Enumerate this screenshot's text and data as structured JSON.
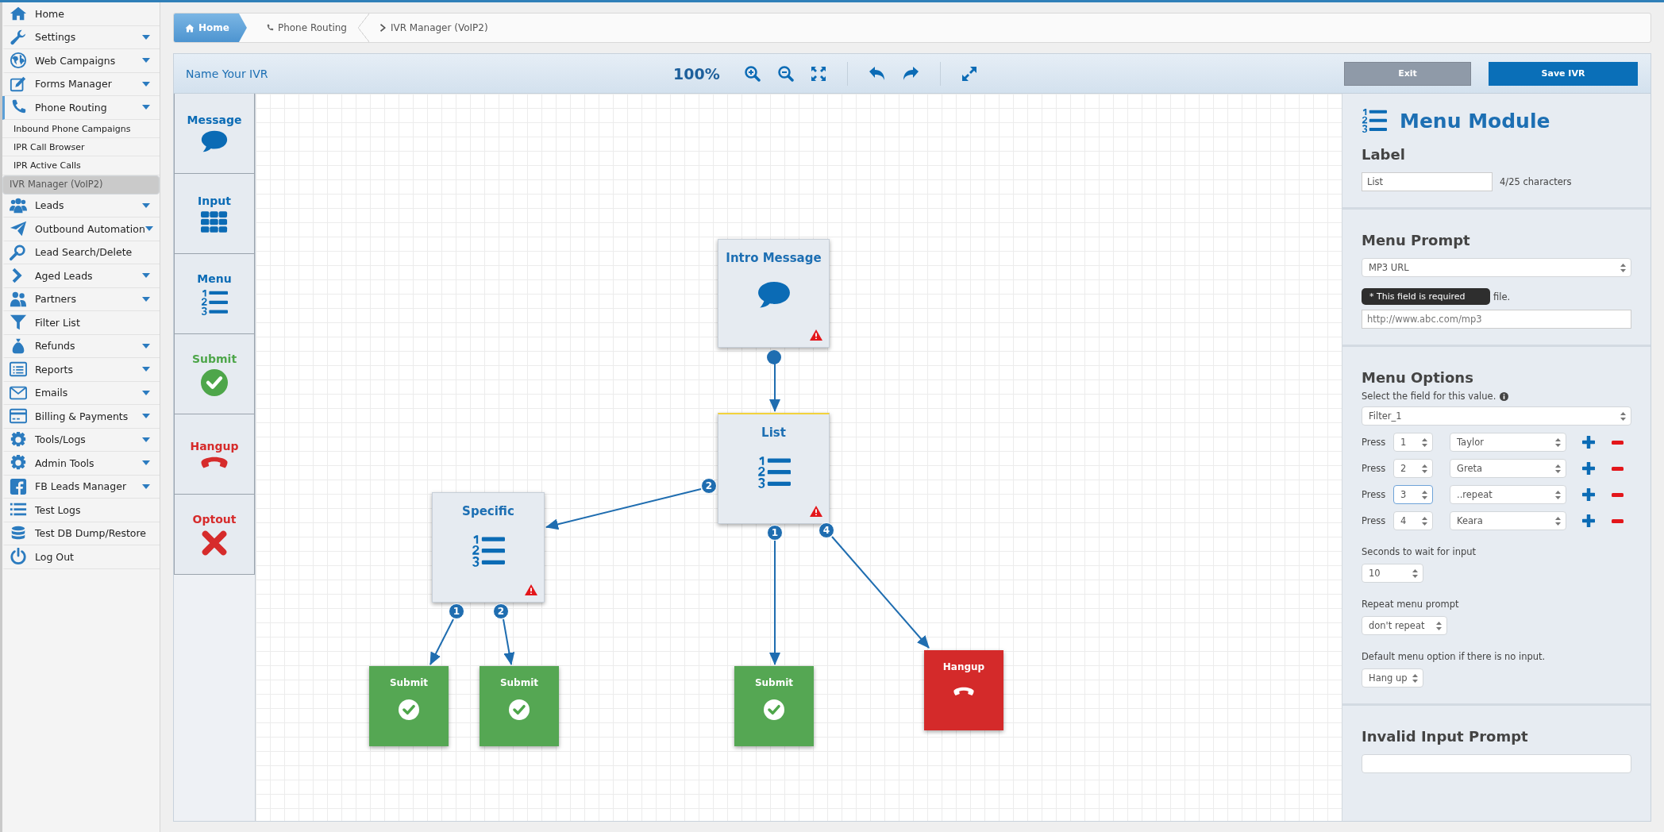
{
  "sidebar": {
    "items": [
      {
        "label": "Home",
        "has_submenu": false,
        "expanded": false
      },
      {
        "label": "Settings",
        "has_submenu": true,
        "expanded": false
      },
      {
        "label": "Web Campaigns",
        "has_submenu": true,
        "expanded": false
      },
      {
        "label": "Forms Manager",
        "has_submenu": true,
        "expanded": false
      },
      {
        "label": "Phone Routing",
        "has_submenu": true,
        "expanded": true,
        "children": [
          {
            "label": "Inbound Phone Campaigns",
            "selected": false
          },
          {
            "label": "IPR Call Browser",
            "selected": false
          },
          {
            "label": "IPR Active Calls",
            "selected": false
          },
          {
            "label": "IVR Manager (VoIP2)",
            "selected": true
          }
        ]
      },
      {
        "label": "Leads",
        "has_submenu": true,
        "expanded": false
      },
      {
        "label": "Outbound Automation",
        "has_submenu": true,
        "expanded": false
      },
      {
        "label": "Lead Search/Delete",
        "has_submenu": false,
        "expanded": false
      },
      {
        "label": "Aged Leads",
        "has_submenu": true,
        "expanded": false
      },
      {
        "label": "Partners",
        "has_submenu": true,
        "expanded": false
      },
      {
        "label": "Filter List",
        "has_submenu": false,
        "expanded": false
      },
      {
        "label": "Refunds",
        "has_submenu": true,
        "expanded": false
      },
      {
        "label": "Reports",
        "has_submenu": true,
        "expanded": false
      },
      {
        "label": "Emails",
        "has_submenu": true,
        "expanded": false
      },
      {
        "label": "Billing & Payments",
        "has_submenu": true,
        "expanded": false
      },
      {
        "label": "Tools/Logs",
        "has_submenu": true,
        "expanded": false
      },
      {
        "label": "Admin Tools",
        "has_submenu": true,
        "expanded": false
      },
      {
        "label": "FB Leads Manager",
        "has_submenu": true,
        "expanded": false
      },
      {
        "label": "Test Logs",
        "has_submenu": false,
        "expanded": false
      },
      {
        "label": "Test DB Dump/Restore",
        "has_submenu": false,
        "expanded": false
      },
      {
        "label": "Log Out",
        "has_submenu": false,
        "expanded": false
      }
    ]
  },
  "breadcrumb": [
    {
      "label": "Home",
      "kind": "home"
    },
    {
      "label": "Phone Routing",
      "kind": "phone"
    },
    {
      "label": "IVR Manager (VoIP2)",
      "kind": "current"
    }
  ],
  "toolbar": {
    "title": "Name Your IVR",
    "zoom": "100%",
    "buttons": [
      {
        "label": "Exit",
        "kind": "secondary"
      },
      {
        "label": "Save IVR",
        "kind": "primary"
      }
    ]
  },
  "palette": [
    {
      "label": "Message",
      "kind": "message"
    },
    {
      "label": "Input",
      "kind": "input"
    },
    {
      "label": "Menu",
      "kind": "menu"
    },
    {
      "label": "Submit",
      "kind": "submit"
    },
    {
      "label": "Hangup",
      "kind": "hangup"
    },
    {
      "label": "Optout",
      "kind": "optout"
    }
  ],
  "canvas": {
    "nodes": [
      {
        "label": "Intro Message",
        "kind": "message",
        "warning": true,
        "selected": false
      },
      {
        "label": "List",
        "kind": "menu",
        "warning": true,
        "selected": true,
        "ports": [
          "2",
          "1",
          "4"
        ]
      },
      {
        "label": "Specific",
        "kind": "menu",
        "warning": true,
        "selected": false,
        "ports": [
          "1",
          "2"
        ]
      },
      {
        "label": "Submit",
        "kind": "submit",
        "warning": false,
        "selected": false
      },
      {
        "label": "Submit",
        "kind": "submit",
        "warning": false,
        "selected": false
      },
      {
        "label": "Submit",
        "kind": "submit",
        "warning": false,
        "selected": false
      },
      {
        "label": "Hangup",
        "kind": "hangup",
        "warning": false,
        "selected": false
      }
    ]
  },
  "panel": {
    "title": "Menu Module",
    "label_section": {
      "heading": "Label",
      "value": "List",
      "counter": "4/25 characters"
    },
    "prompt_section": {
      "heading": "Menu Prompt",
      "type": "MP3 URL",
      "tooltip": "* This field is required",
      "hint": "file.",
      "placeholder": "http://www.abc.com/mp3"
    },
    "options_section": {
      "heading": "Menu Options",
      "field_label": "Select the field for this value.",
      "field": "Filter_1",
      "options": [
        {
          "prefix": "Press",
          "key": "1",
          "target": "Taylor",
          "focused": false
        },
        {
          "prefix": "Press",
          "key": "2",
          "target": "Greta",
          "focused": false
        },
        {
          "prefix": "Press",
          "key": "3",
          "target": "..repeat",
          "focused": true
        },
        {
          "prefix": "Press",
          "key": "4",
          "target": "Keara",
          "focused": false
        }
      ],
      "wait_label": "Seconds to wait for input",
      "wait": "10",
      "repeat_label": "Repeat menu prompt",
      "repeat": "don't repeat",
      "default_label": "Default menu option if there is no input.",
      "default": "Hang up"
    },
    "invalid_section": {
      "heading": "Invalid Input Prompt"
    }
  }
}
